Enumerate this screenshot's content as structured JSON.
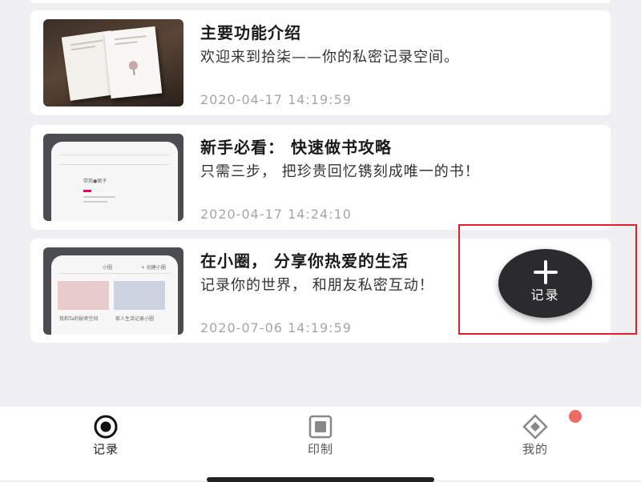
{
  "feed": {
    "cards": [
      {
        "title": "主要功能介绍",
        "description": "欢迎来到拾柒——你的私密记录空间。",
        "timestamp": "2020-04-17 14:19:59",
        "thumbnail": "books-photo"
      },
      {
        "title": "新手必看： 快速做书攻略",
        "description": "只需三步， 把珍贵回忆镌刻成唯一的书！",
        "timestamp": "2020-04-17 14:24:10",
        "thumbnail": "phone-screenshot-bookmaking"
      },
      {
        "title": "在小圈， 分享你热爱的生活",
        "description": "记录你的世界， 和朋友私密互动！",
        "timestamp": "2020-07-06 14:19:59",
        "thumbnail": "phone-screenshot-circle"
      }
    ],
    "thumb2_texts": {
      "tag": "带我●图子"
    },
    "thumb3_texts": {
      "header": "小圈",
      "create": "+ 创建小圈",
      "left_caption": "我和Ta的秘密空间",
      "right_caption": "家人生活记录小圈"
    }
  },
  "fab": {
    "label": "记录",
    "icon": "plus-icon",
    "highlight_color": "#e0202a"
  },
  "nav": {
    "items": [
      {
        "label": "记录",
        "icon": "record-target-icon",
        "active": true
      },
      {
        "label": "印制",
        "icon": "print-square-icon",
        "active": false
      },
      {
        "label": "我的",
        "icon": "diamond-profile-icon",
        "active": false,
        "badge": true
      }
    ],
    "badge_color": "#ee6b63"
  }
}
